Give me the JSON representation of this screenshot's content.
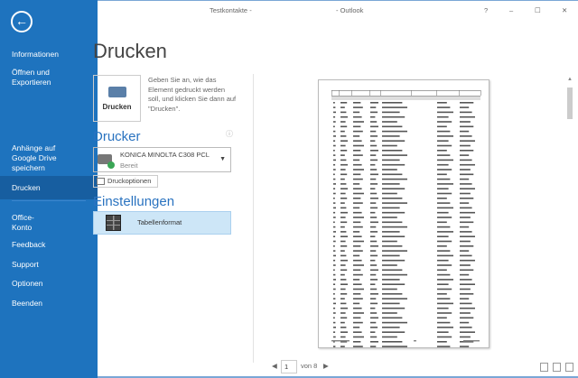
{
  "window": {
    "title_left": "Testkontakte -",
    "title_right": "- Outlook",
    "help": "?",
    "minimize": "–",
    "maximize": "☐",
    "close": "✕"
  },
  "sidebar": {
    "back": "←",
    "items": [
      {
        "label": "Informationen"
      },
      {
        "label": "Öffnen und Exportieren"
      },
      {
        "label": ""
      },
      {
        "label": ""
      },
      {
        "label": "Anhänge auf Google Drive speichern"
      },
      {
        "label": "Drucken"
      },
      {
        "label": "Office-Konto"
      },
      {
        "label": "Feedback"
      },
      {
        "label": "Support"
      },
      {
        "label": "Optionen"
      },
      {
        "label": "Beenden"
      }
    ]
  },
  "main": {
    "title": "Drucken",
    "print_button": "Drucken",
    "description": "Geben Sie an, wie das Element gedruckt werden soll, und klicken Sie dann auf \"Drucken\".",
    "printer_heading": "Drucker",
    "printer_name": "KONICA MINOLTA C308 PCL",
    "printer_status": "Bereit",
    "print_options": "Druckoptionen",
    "settings_heading": "Einstellungen",
    "format": "Tabellenformat"
  },
  "preview": {
    "page": "1",
    "of_label": "von 8"
  },
  "colors": {
    "accent": "#1e73be",
    "selected": "#175ea0",
    "format_bg": "#cde6f7"
  }
}
